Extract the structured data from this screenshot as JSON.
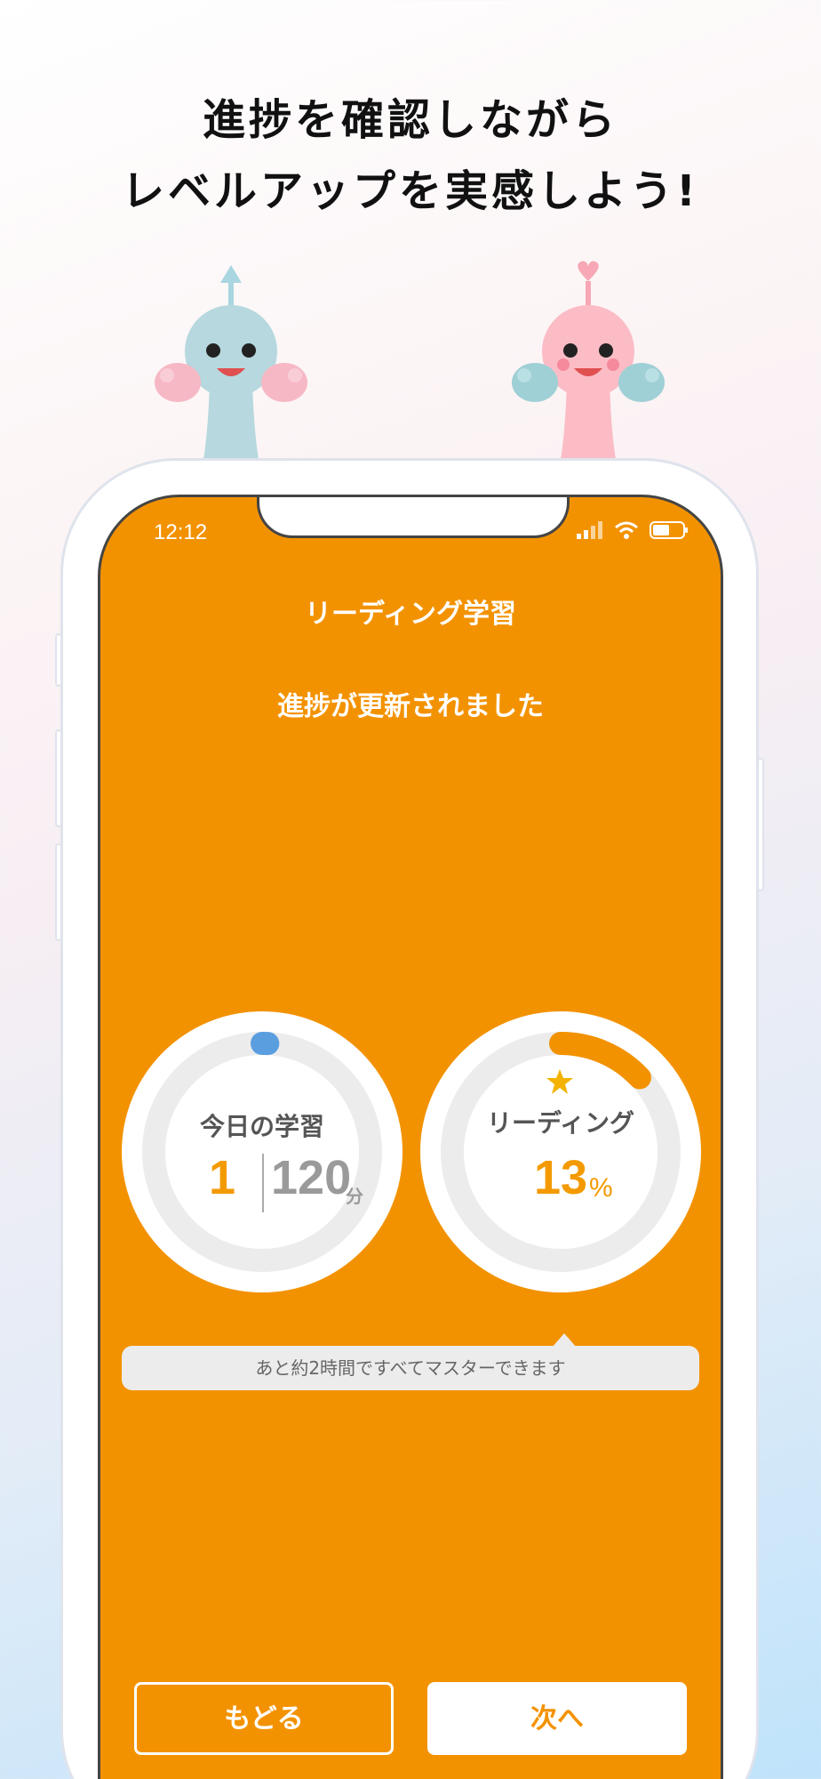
{
  "headline": {
    "line1": "進捗を確認しながら",
    "line2": "レベルアップを実感しよう!"
  },
  "status_bar": {
    "time": "12:12",
    "icons": [
      "signal-icon",
      "wifi-icon",
      "battery-icon"
    ]
  },
  "screen": {
    "title": "リーディング学習",
    "message": "進捗が更新されました"
  },
  "today_card": {
    "label": "今日の学習",
    "value": "1",
    "goal": "120",
    "unit": "分",
    "progress": 0.0083
  },
  "reading_card": {
    "label": "リーディング",
    "value": "13",
    "unit": "%",
    "progress": 0.13,
    "icon": "star-icon"
  },
  "tooltip": "あと約2時間ですべてマスターできます",
  "buttons": {
    "back": "もどる",
    "next": "次へ"
  },
  "colors": {
    "accent": "#f39200",
    "ring_track": "#ececec",
    "today_ring": "#5b9ee0",
    "reading_ring": "#f39200"
  }
}
